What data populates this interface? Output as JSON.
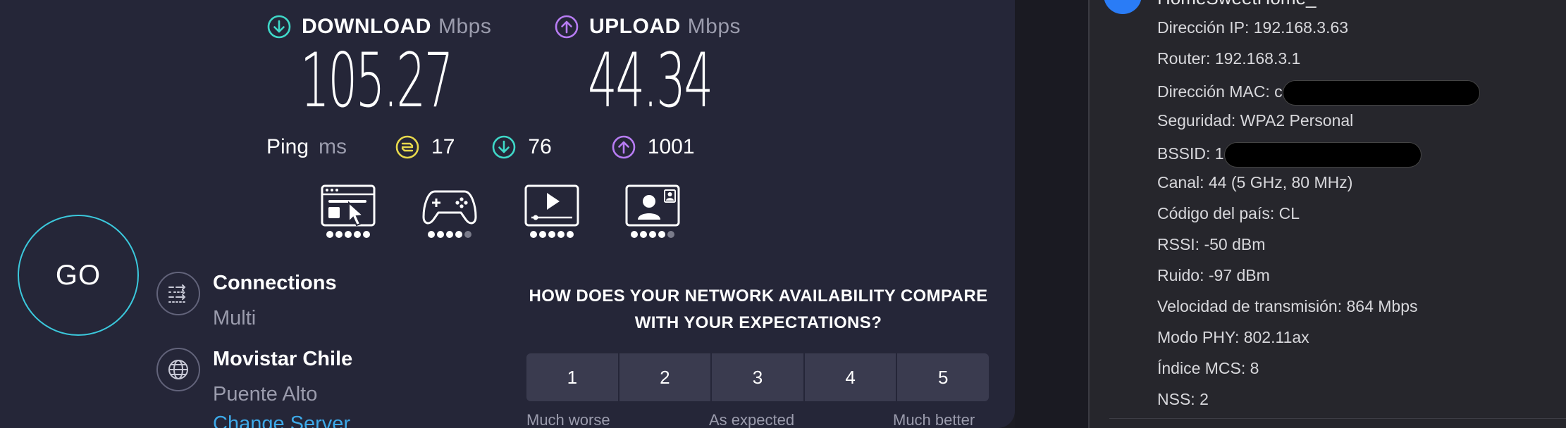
{
  "speedtest": {
    "download": {
      "label": "DOWNLOAD",
      "unit": "Mbps",
      "value": "105.27"
    },
    "upload": {
      "label": "UPLOAD",
      "unit": "Mbps",
      "value": "44.34"
    },
    "ping": {
      "label": "Ping",
      "unit": "ms",
      "idle": "17",
      "download": "76",
      "upload": "1001"
    },
    "ratings": [
      {
        "icon": "web-browsing-icon",
        "filled": 5,
        "total": 5
      },
      {
        "icon": "gaming-icon",
        "filled": 4,
        "total": 5
      },
      {
        "icon": "video-streaming-icon",
        "filled": 5,
        "total": 5
      },
      {
        "icon": "video-chat-icon",
        "filled": 4,
        "total": 5
      }
    ],
    "go_label": "GO",
    "connections": {
      "title": "Connections",
      "value": "Multi"
    },
    "server": {
      "title": "Movistar Chile",
      "location": "Puente Alto",
      "change_link": "Change Server"
    },
    "survey": {
      "question": "HOW DOES YOUR NETWORK AVAILABILITY COMPARE WITH YOUR EXPECTATIONS?",
      "options": [
        "1",
        "2",
        "3",
        "4",
        "5"
      ],
      "low_label": "Much worse",
      "mid_label": "As expected",
      "high_label": "Much better"
    },
    "colors": {
      "download": "#3fd8c8",
      "upload": "#b77cf3",
      "ping_idle": "#e8d94c",
      "go_ring": "#3bc8dc",
      "link": "#3da9e8"
    }
  },
  "wifi": {
    "network_name": "HomeSweetHome_",
    "details": {
      "ip": "Dirección IP: 192.168.3.63",
      "router": "Router: 192.168.3.1",
      "mac": "Dirección MAC: c",
      "security": "Seguridad: WPA2 Personal",
      "bssid": "BSSID: 1",
      "channel": "Canal: 44 (5 GHz, 80 MHz)",
      "country": "Código del país: CL",
      "rssi": "RSSI: -50 dBm",
      "noise": "Ruido: -97 dBm",
      "tx_rate": "Velocidad de transmisión: 864 Mbps",
      "phy": "Modo PHY: 802.11ax",
      "mcs": "Índice MCS: 8",
      "nss": "NSS: 2"
    }
  }
}
